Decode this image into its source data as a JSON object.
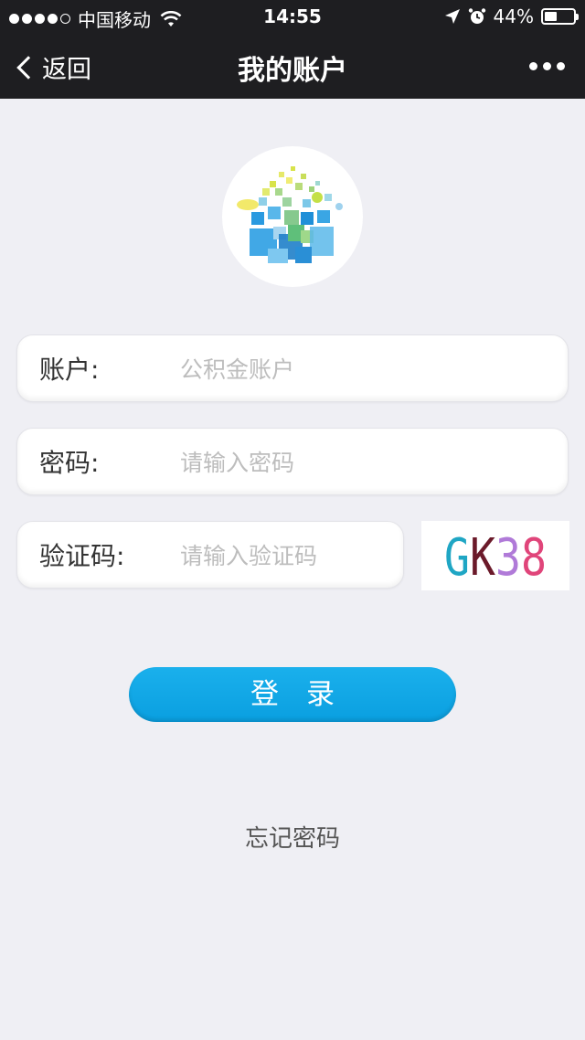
{
  "status_bar": {
    "carrier": "中国移动",
    "time": "14:55",
    "battery": "44%",
    "battery_level": 0.44,
    "icons": [
      "signal-dots-icon",
      "wifi-icon",
      "location-arrow-icon",
      "alarm-icon",
      "battery-icon"
    ]
  },
  "nav": {
    "back_label": "返回",
    "title": "我的账户",
    "more_icon": "more-dots-icon"
  },
  "logo": {
    "icon": "housing-fund-logo-icon"
  },
  "form": {
    "account": {
      "label": "账户:",
      "placeholder": "公积金账户",
      "value": ""
    },
    "password": {
      "label": "密码:",
      "placeholder": "请输入密码",
      "value": ""
    },
    "captcha": {
      "label": "验证码:",
      "placeholder": "请输入验证码",
      "value": "",
      "image_text": "GK38"
    }
  },
  "login_label": "登录",
  "forgot_label": "忘记密码",
  "colors": {
    "nav_bg": "#1e1e21",
    "page_bg": "#efeff4",
    "button_blue": "#0aa4e6",
    "captcha_colors": [
      "#1fa6c4",
      "#6b1a2a",
      "#b07ad8",
      "#e0457a"
    ]
  }
}
